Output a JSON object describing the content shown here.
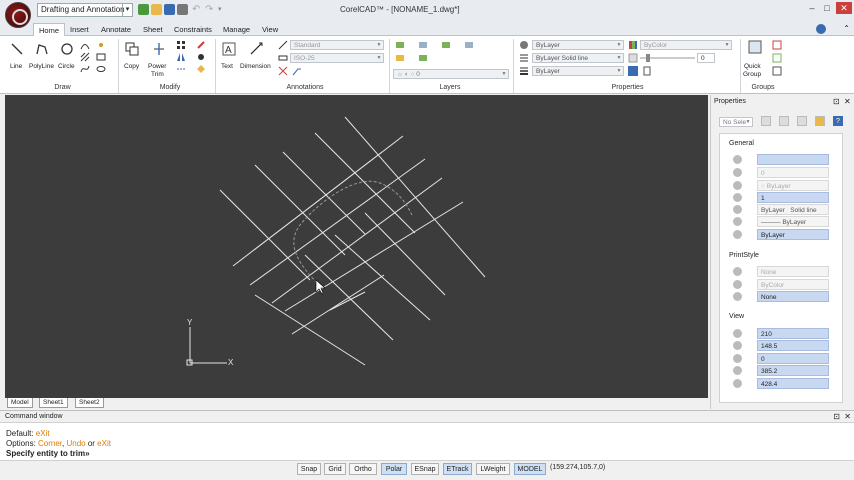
{
  "titlebar": {
    "workspace": "Drafting and Annotation",
    "title": "CorelCAD™ - [NONAME_1.dwg*]"
  },
  "menu": {
    "tabs": [
      "Home",
      "Insert",
      "Annotate",
      "Sheet",
      "Constraints",
      "Manage",
      "View"
    ],
    "active": "Home"
  },
  "ribbon": {
    "draw": {
      "label": "Draw",
      "line": "Line",
      "polyline": "PolyLine",
      "circle": "Circle"
    },
    "modify": {
      "label": "Modify",
      "copy": "Copy",
      "power": "Power",
      "trim": "Trim"
    },
    "annotations": {
      "label": "Annotations",
      "text": "Text",
      "dimension": "Dimension",
      "text_style": "Standard",
      "dim_style": "ISO-25"
    },
    "layers": {
      "label": "Layers",
      "layer_value": "0"
    },
    "properties": {
      "label": "Properties",
      "color": "ByLayer",
      "linestyle": "ByLayer",
      "linestyle_type": "Solid line",
      "lineweight": "ByLayer",
      "print_color": "ByColor",
      "transparency": "0"
    },
    "groups": {
      "label": "Groups",
      "quick_group_1": "Quick",
      "quick_group_2": "Group"
    }
  },
  "canvas": {
    "ucs_x": "X",
    "ucs_y": "Y",
    "sheet_tabs": [
      "Model",
      "Sheet1",
      "Sheet2"
    ]
  },
  "properties_panel": {
    "title": "Properties",
    "selection": "No Sele",
    "general_title": "General",
    "general": {
      "color": "",
      "layer": "0",
      "linecolor": "ByLayer",
      "lineweight_scale": "1",
      "linestyle": "ByLayer",
      "linestyle_type": "Solid line",
      "lineweight": "ByLayer",
      "lineweight_selected": "ByLayer"
    },
    "printstyle_title": "PrintStyle",
    "printstyle": {
      "style": "None",
      "color": "ByColor",
      "table": "None"
    },
    "view_title": "View",
    "view": {
      "center_x": "210",
      "center_y": "148.5",
      "center_z": "0",
      "height": "385.2",
      "width": "428.4"
    }
  },
  "command_window": {
    "title": "Command window",
    "default_prefix": "Default: ",
    "default_value": "eXit",
    "options_prefix": "Options: ",
    "opt1": "Corner",
    "sep1": ", ",
    "opt2": "Undo",
    "sep2": " or ",
    "opt3": "eXit",
    "prompt": "Specify entity to trim»"
  },
  "status": {
    "buttons": [
      "Snap",
      "Grid",
      "Ortho",
      "Polar",
      "ESnap",
      "ETrack",
      "LWeight",
      "MODEL"
    ],
    "active": [
      "Polar",
      "ETrack",
      "MODEL"
    ],
    "coords": "(159.274,105.7,0)"
  },
  "colors": {
    "canvas_bg": "#3c3c3c",
    "drawing_line": "#e6e6e6",
    "highlight_blue": "#c8d8f0",
    "accent_orange": "#e07b00"
  }
}
